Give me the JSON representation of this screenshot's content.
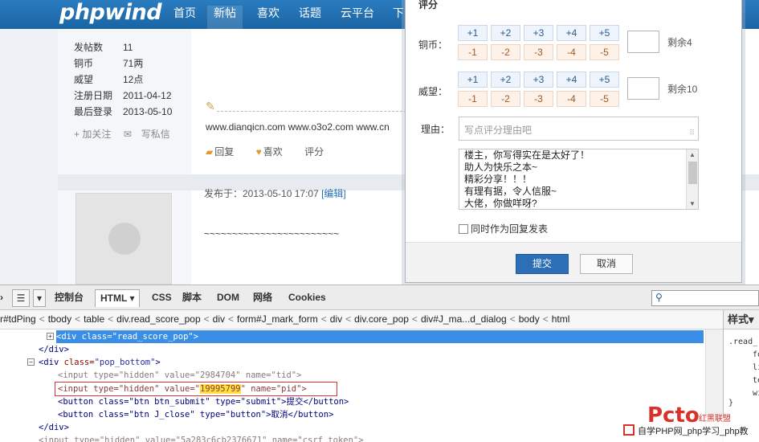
{
  "nav": {
    "logo": "phpwind",
    "items": [
      "首页",
      "新帖",
      "喜欢",
      "话题",
      "云平台",
      "下"
    ]
  },
  "profile": {
    "rows": [
      {
        "k": "发帖数",
        "v": "11"
      },
      {
        "k": "铜币",
        "v": "71两"
      },
      {
        "k": "威望",
        "v": "12点"
      },
      {
        "k": "注册日期",
        "v": "2011-04-12"
      },
      {
        "k": "最后登录",
        "v": "2013-05-10"
      }
    ],
    "follow": "+ 加关注",
    "message": "写私信"
  },
  "post": {
    "signature": "www.dianqicn.com www.o3o2.com www.cn",
    "reply": "回复",
    "like": "喜欢",
    "score": "评分",
    "posted_label": "发布于：2013-05-10 17:07",
    "edit": "[编辑]",
    "tilde": "~~~~~~~~~~~~~~~~~~~~~~~~"
  },
  "popup": {
    "title": "评分",
    "copper_label": "铜币：",
    "prestige_label": "威望：",
    "plus": [
      "+1",
      "+2",
      "+3",
      "+4",
      "+5"
    ],
    "minus": [
      "-1",
      "-2",
      "-3",
      "-4",
      "-5"
    ],
    "copper_remain": "剩余4",
    "prestige_remain": "剩余10",
    "reason_label": "理由：",
    "reason_placeholder": "写点评分理由吧",
    "reasons": [
      "楼主，你写得实在是太好了！",
      "助人为快乐之本~",
      "精彩分享！！！",
      "有理有据，令人信服~",
      "大佬，你做咩呀?"
    ],
    "checkbox": "同时作为回复发表",
    "submit": "提交",
    "cancel": "取消"
  },
  "firebug": {
    "tabs": [
      "控制台",
      "HTML",
      "CSS",
      "脚本",
      "DOM",
      "网络",
      "Cookies"
    ],
    "breadcrumbs": [
      "r#tdPing",
      "tbody",
      "table",
      "div.read_score_pop",
      "div",
      "form#J_mark_form",
      "div",
      "div.core_pop",
      "div#J_ma...d_dialog",
      "body",
      "html"
    ],
    "code": [
      {
        "pre": "<",
        "tag": "div",
        "a1": " class=",
        "v1": "\"read_score_pop\"",
        "post": ">"
      },
      {
        "text": "</div>"
      },
      {
        "pre": "<",
        "tag": "div",
        "a1": " class=",
        "v1": "\"pop_bottom\"",
        "post": ">"
      },
      {
        "text": "<input type=\"hidden\" value=\"2984704\" name=\"tid\">"
      },
      {
        "a": "<input type=\"hidden\" value=\"",
        "hl": "19995799",
        "b": "\" name=\"pid\">"
      },
      {
        "text": "<button class=\"btn btn_submit\" type=\"submit\">提交</button>"
      },
      {
        "text": "<button class=\"btn J_close\" type=\"button\">取消</button>"
      },
      {
        "text": "</div>"
      },
      {
        "text": "<input type=\"hidden\" value=\"5a283c6cb2376671\" name=\"csrf_token\">"
      }
    ],
    "style_head": "样式",
    "style_lines": [
      ".read_",
      "fo",
      "li",
      "te",
      "wi",
      "}"
    ]
  },
  "watermark": {
    "big": "Pcto",
    "red": "红黑联盟",
    "text": "自学PHP网_php学习_php教"
  }
}
